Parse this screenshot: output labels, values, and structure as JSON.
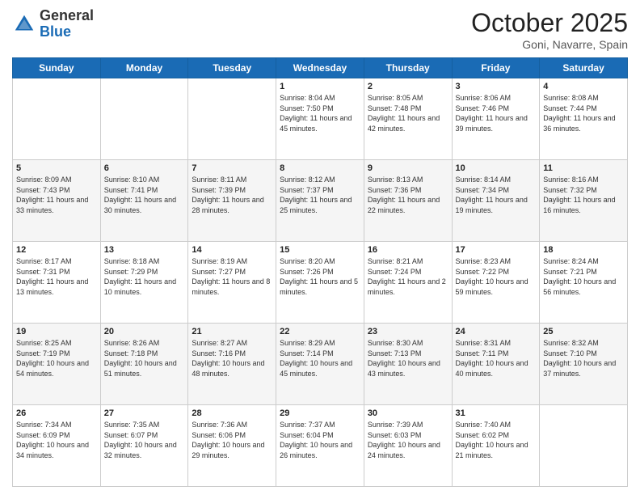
{
  "header": {
    "logo_general": "General",
    "logo_blue": "Blue",
    "month_title": "October 2025",
    "subtitle": "Goni, Navarre, Spain"
  },
  "weekdays": [
    "Sunday",
    "Monday",
    "Tuesday",
    "Wednesday",
    "Thursday",
    "Friday",
    "Saturday"
  ],
  "rows": [
    [
      {
        "day": "",
        "empty": true
      },
      {
        "day": "",
        "empty": true
      },
      {
        "day": "",
        "empty": true
      },
      {
        "day": "1",
        "text": "Sunrise: 8:04 AM\nSunset: 7:50 PM\nDaylight: 11 hours and 45 minutes."
      },
      {
        "day": "2",
        "text": "Sunrise: 8:05 AM\nSunset: 7:48 PM\nDaylight: 11 hours and 42 minutes."
      },
      {
        "day": "3",
        "text": "Sunrise: 8:06 AM\nSunset: 7:46 PM\nDaylight: 11 hours and 39 minutes."
      },
      {
        "day": "4",
        "text": "Sunrise: 8:08 AM\nSunset: 7:44 PM\nDaylight: 11 hours and 36 minutes."
      }
    ],
    [
      {
        "day": "5",
        "text": "Sunrise: 8:09 AM\nSunset: 7:43 PM\nDaylight: 11 hours and 33 minutes."
      },
      {
        "day": "6",
        "text": "Sunrise: 8:10 AM\nSunset: 7:41 PM\nDaylight: 11 hours and 30 minutes."
      },
      {
        "day": "7",
        "text": "Sunrise: 8:11 AM\nSunset: 7:39 PM\nDaylight: 11 hours and 28 minutes."
      },
      {
        "day": "8",
        "text": "Sunrise: 8:12 AM\nSunset: 7:37 PM\nDaylight: 11 hours and 25 minutes."
      },
      {
        "day": "9",
        "text": "Sunrise: 8:13 AM\nSunset: 7:36 PM\nDaylight: 11 hours and 22 minutes."
      },
      {
        "day": "10",
        "text": "Sunrise: 8:14 AM\nSunset: 7:34 PM\nDaylight: 11 hours and 19 minutes."
      },
      {
        "day": "11",
        "text": "Sunrise: 8:16 AM\nSunset: 7:32 PM\nDaylight: 11 hours and 16 minutes."
      }
    ],
    [
      {
        "day": "12",
        "text": "Sunrise: 8:17 AM\nSunset: 7:31 PM\nDaylight: 11 hours and 13 minutes."
      },
      {
        "day": "13",
        "text": "Sunrise: 8:18 AM\nSunset: 7:29 PM\nDaylight: 11 hours and 10 minutes."
      },
      {
        "day": "14",
        "text": "Sunrise: 8:19 AM\nSunset: 7:27 PM\nDaylight: 11 hours and 8 minutes."
      },
      {
        "day": "15",
        "text": "Sunrise: 8:20 AM\nSunset: 7:26 PM\nDaylight: 11 hours and 5 minutes."
      },
      {
        "day": "16",
        "text": "Sunrise: 8:21 AM\nSunset: 7:24 PM\nDaylight: 11 hours and 2 minutes."
      },
      {
        "day": "17",
        "text": "Sunrise: 8:23 AM\nSunset: 7:22 PM\nDaylight: 10 hours and 59 minutes."
      },
      {
        "day": "18",
        "text": "Sunrise: 8:24 AM\nSunset: 7:21 PM\nDaylight: 10 hours and 56 minutes."
      }
    ],
    [
      {
        "day": "19",
        "text": "Sunrise: 8:25 AM\nSunset: 7:19 PM\nDaylight: 10 hours and 54 minutes."
      },
      {
        "day": "20",
        "text": "Sunrise: 8:26 AM\nSunset: 7:18 PM\nDaylight: 10 hours and 51 minutes."
      },
      {
        "day": "21",
        "text": "Sunrise: 8:27 AM\nSunset: 7:16 PM\nDaylight: 10 hours and 48 minutes."
      },
      {
        "day": "22",
        "text": "Sunrise: 8:29 AM\nSunset: 7:14 PM\nDaylight: 10 hours and 45 minutes."
      },
      {
        "day": "23",
        "text": "Sunrise: 8:30 AM\nSunset: 7:13 PM\nDaylight: 10 hours and 43 minutes."
      },
      {
        "day": "24",
        "text": "Sunrise: 8:31 AM\nSunset: 7:11 PM\nDaylight: 10 hours and 40 minutes."
      },
      {
        "day": "25",
        "text": "Sunrise: 8:32 AM\nSunset: 7:10 PM\nDaylight: 10 hours and 37 minutes."
      }
    ],
    [
      {
        "day": "26",
        "text": "Sunrise: 7:34 AM\nSunset: 6:09 PM\nDaylight: 10 hours and 34 minutes."
      },
      {
        "day": "27",
        "text": "Sunrise: 7:35 AM\nSunset: 6:07 PM\nDaylight: 10 hours and 32 minutes."
      },
      {
        "day": "28",
        "text": "Sunrise: 7:36 AM\nSunset: 6:06 PM\nDaylight: 10 hours and 29 minutes."
      },
      {
        "day": "29",
        "text": "Sunrise: 7:37 AM\nSunset: 6:04 PM\nDaylight: 10 hours and 26 minutes."
      },
      {
        "day": "30",
        "text": "Sunrise: 7:39 AM\nSunset: 6:03 PM\nDaylight: 10 hours and 24 minutes."
      },
      {
        "day": "31",
        "text": "Sunrise: 7:40 AM\nSunset: 6:02 PM\nDaylight: 10 hours and 21 minutes."
      },
      {
        "day": "",
        "empty": true
      }
    ]
  ]
}
